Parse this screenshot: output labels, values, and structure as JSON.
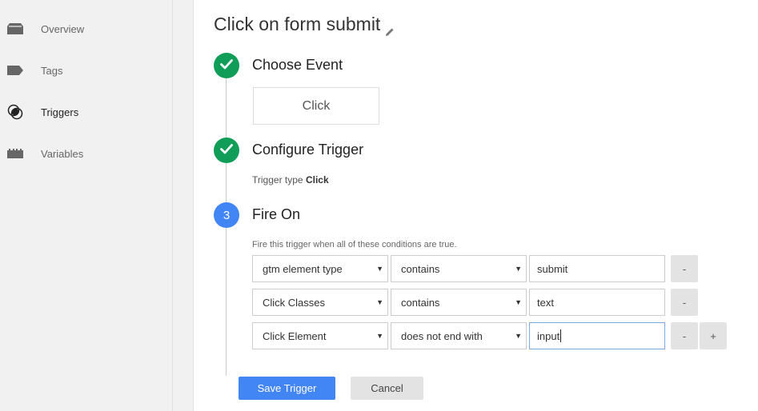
{
  "sidebar": {
    "items": [
      {
        "label": "Overview",
        "icon": "overview-icon",
        "active": false
      },
      {
        "label": "Tags",
        "icon": "tag-icon",
        "active": false
      },
      {
        "label": "Triggers",
        "icon": "trigger-icon",
        "active": true
      },
      {
        "label": "Variables",
        "icon": "variables-icon",
        "active": false
      }
    ]
  },
  "page": {
    "title": "Click on form submit",
    "edit_icon": "pencil-icon"
  },
  "steps": [
    {
      "status": "done",
      "title": "Choose Event",
      "event_label": "Click"
    },
    {
      "status": "done",
      "title": "Configure Trigger",
      "trigger_type_label": "Trigger type",
      "trigger_type_value": "Click"
    },
    {
      "status": "active",
      "number": "3",
      "title": "Fire On",
      "description": "Fire this trigger when all of these conditions are true."
    }
  ],
  "conditions": [
    {
      "variable": "gtm element type",
      "operator": "contains",
      "value": "submit"
    },
    {
      "variable": "Click Classes",
      "operator": "contains",
      "value": "text"
    },
    {
      "variable": "Click Element",
      "operator": "does not end with",
      "value": "input"
    }
  ],
  "buttons": {
    "remove": "-",
    "add": "+",
    "save": "Save Trigger",
    "cancel": "Cancel"
  },
  "colors": {
    "done": "#0f9d58",
    "active": "#4285f4",
    "primary_button": "#4285f4"
  }
}
